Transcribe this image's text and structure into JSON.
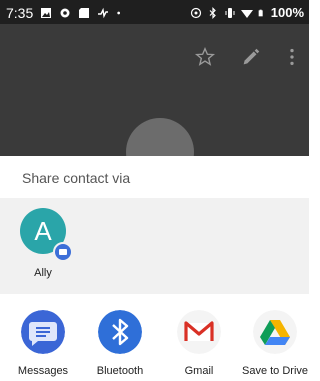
{
  "status_bar": {
    "time": "7:35",
    "battery": "100%"
  },
  "sheet": {
    "title": "Share contact via",
    "direct_targets": [
      {
        "label": "Ally",
        "initial": "A"
      }
    ],
    "apps": [
      {
        "label": "Messages"
      },
      {
        "label": "Bluetooth"
      },
      {
        "label": "Gmail"
      },
      {
        "label": "Save to Drive"
      }
    ]
  },
  "colors": {
    "appbar": "#3a3a3a",
    "statusbar": "#1f1f1f",
    "avatar": "#2aa5a9",
    "messages": "#3b66d6",
    "bluetooth": "#2f6fd8",
    "gmail_red": "#d93025"
  }
}
